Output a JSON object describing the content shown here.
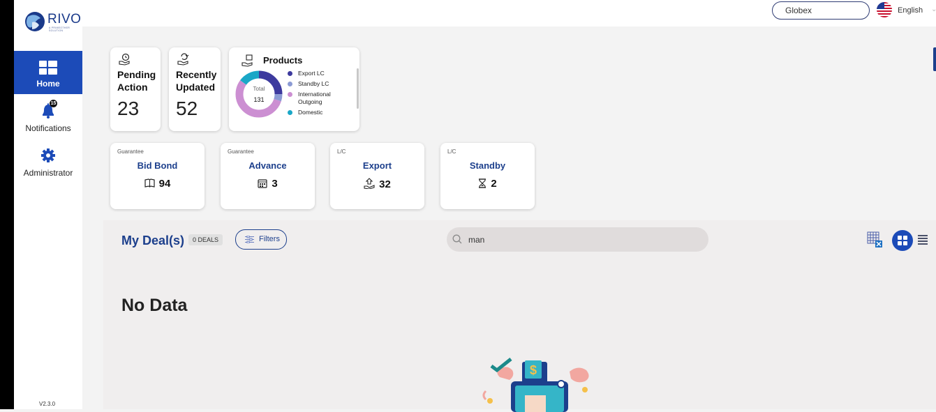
{
  "brand": {
    "name": "RIVO",
    "tagline": "A PRIMEOTHER SOLUTION"
  },
  "header": {
    "entity": "Globex",
    "language": "English"
  },
  "sidebar": {
    "items": [
      {
        "label": "Home"
      },
      {
        "label": "Notifications",
        "badge": "15"
      },
      {
        "label": "Administrator"
      }
    ],
    "version": "V2.3.0"
  },
  "stats": {
    "pending": {
      "title_line1": "Pending",
      "title_line2": "Action",
      "value": "23"
    },
    "recent": {
      "title_line1": "Recently",
      "title_line2": "Updated",
      "value": "52"
    }
  },
  "products": {
    "title": "Products",
    "total_label": "Total",
    "total_value": "131",
    "legend": [
      {
        "name": "Export LC",
        "color": "#3d3a9e"
      },
      {
        "name": "Standby LC",
        "color": "#8c9bd4"
      },
      {
        "name": "International Outgoing",
        "color": "#cc8fd2"
      },
      {
        "name": "Domestic",
        "color": "#1aa7c7"
      }
    ]
  },
  "categories": [
    {
      "category": "Guarantee",
      "name": "Bid Bond",
      "count": "94",
      "icon": "book-icon"
    },
    {
      "category": "Guarantee",
      "name": "Advance",
      "count": "3",
      "icon": "calendar-icon"
    },
    {
      "category": "L/C",
      "name": "Export",
      "count": "32",
      "icon": "export-icon"
    },
    {
      "category": "L/C",
      "name": "Standby",
      "count": "2",
      "icon": "hourglass-icon"
    }
  ],
  "deals": {
    "title": "My Deal(s)",
    "count_badge": "0 DEALS",
    "filters_label": "Filters",
    "search_value": "man",
    "empty_text": "No Data"
  }
}
